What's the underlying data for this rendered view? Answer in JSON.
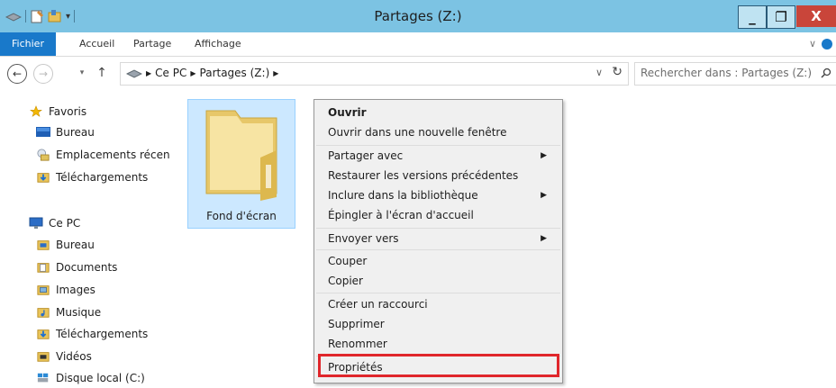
{
  "window": {
    "title": "Partages (Z:)",
    "minimize": "_",
    "maximize": "❐",
    "close": "X"
  },
  "ribbon": {
    "tabs": [
      "Fichier",
      "Accueil",
      "Partage",
      "Affichage"
    ]
  },
  "address": {
    "crumbs": [
      "Ce PC",
      "Partages (Z:)"
    ],
    "search_placeholder": "Rechercher dans : Partages (Z:)"
  },
  "nav": {
    "favorites_label": "Favoris",
    "favorites": [
      "Bureau",
      "Emplacements récen",
      "Téléchargements"
    ],
    "thispc_label": "Ce PC",
    "thispc": [
      "Bureau",
      "Documents",
      "Images",
      "Musique",
      "Téléchargements",
      "Vidéos",
      "Disque local (C:)"
    ]
  },
  "content": {
    "folder_name": "Fond d'écran"
  },
  "context_menu": {
    "items": [
      {
        "label": "Ouvrir",
        "bold": true
      },
      {
        "label": "Ouvrir dans une nouvelle fenêtre"
      },
      {
        "label": "Partager avec",
        "submenu": true
      },
      {
        "label": "Restaurer les versions précédentes"
      },
      {
        "label": "Inclure dans la bibliothèque",
        "submenu": true
      },
      {
        "label": "Épingler à l'écran d'accueil"
      },
      {
        "label": "Envoyer vers",
        "submenu": true
      },
      {
        "label": "Couper"
      },
      {
        "label": "Copier"
      },
      {
        "label": "Créer un raccourci"
      },
      {
        "label": "Supprimer"
      },
      {
        "label": "Renommer"
      },
      {
        "label": "Propriétés"
      }
    ]
  },
  "colors": {
    "titlebar": "#7cc3e3",
    "fichier_tab": "#1979ca",
    "close": "#c9453a",
    "selection": "#cce8ff",
    "highlight": "#e0262b"
  }
}
